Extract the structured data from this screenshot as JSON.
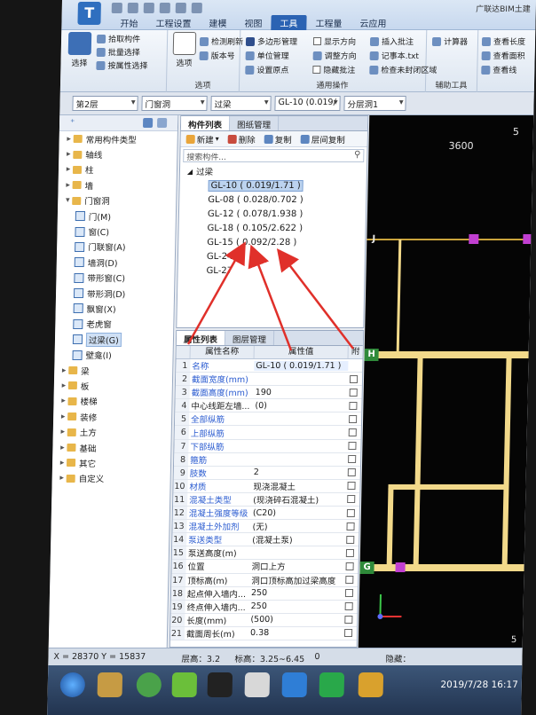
{
  "title_bar": {
    "logo_text": "T",
    "menu_tabs": [
      "开始",
      "工程设置",
      "建模",
      "视图",
      "工具",
      "工程量",
      "云应用"
    ],
    "active_tab": "工具",
    "brand_text": "广联达BIM土建"
  },
  "ribbon": {
    "select_group": {
      "select_button": "选择",
      "pick_component": "拾取构件",
      "batch_select": "批量选择",
      "select_by_attr": "按属性选择"
    },
    "options_group": {
      "options_button": "选项",
      "check_refresh": "检测刷新",
      "version": "版本号",
      "label": "选项"
    },
    "common_group": {
      "polygon_mgmt": "多边形管理",
      "show_direction": "显示方向",
      "insert_annotation": "插入批注",
      "unit_mgmt": "单位管理",
      "adjust_direction": "调整方向",
      "notepad": "记事本.txt",
      "set_origin": "设置原点",
      "hide_annotation": "隐藏批注",
      "check_unclosed": "检查未封闭区域",
      "label": "通用操作"
    },
    "aux_group": {
      "calculator": "计算器",
      "label": "辅助工具"
    },
    "view_group": {
      "view_length": "查看长度",
      "view_area": "查看面积",
      "view_line": "查看线"
    }
  },
  "selector_bar": {
    "floor": "第2层",
    "category": "门窗洞",
    "type": "过梁",
    "component": "GL-10 (0.019/",
    "layer": "分层洞1"
  },
  "tree": {
    "items": [
      {
        "label": "常用构件类型",
        "toggle": "▸",
        "kind": "folder"
      },
      {
        "label": "轴线",
        "toggle": "▸",
        "kind": "folder"
      },
      {
        "label": "柱",
        "toggle": "▸",
        "kind": "folder"
      },
      {
        "label": "墙",
        "toggle": "▸",
        "kind": "folder"
      },
      {
        "label": "门窗洞",
        "toggle": "▾",
        "kind": "folder"
      },
      {
        "label": "门(M)",
        "toggle": "",
        "kind": "child"
      },
      {
        "label": "窗(C)",
        "toggle": "",
        "kind": "child"
      },
      {
        "label": "门联窗(A)",
        "toggle": "",
        "kind": "child"
      },
      {
        "label": "墙洞(D)",
        "toggle": "",
        "kind": "child"
      },
      {
        "label": "带形窗(C)",
        "toggle": "",
        "kind": "child"
      },
      {
        "label": "带形洞(D)",
        "toggle": "",
        "kind": "child"
      },
      {
        "label": "飘窗(X)",
        "toggle": "",
        "kind": "child"
      },
      {
        "label": "老虎窗",
        "toggle": "",
        "kind": "child"
      },
      {
        "label": "过梁(G)",
        "toggle": "",
        "kind": "child",
        "selected": true
      },
      {
        "label": "壁龛(I)",
        "toggle": "",
        "kind": "child"
      },
      {
        "label": "梁",
        "toggle": "▸",
        "kind": "folder"
      },
      {
        "label": "板",
        "toggle": "▸",
        "kind": "folder"
      },
      {
        "label": "楼梯",
        "toggle": "▸",
        "kind": "folder"
      },
      {
        "label": "装修",
        "toggle": "▸",
        "kind": "folder"
      },
      {
        "label": "土方",
        "toggle": "▸",
        "kind": "folder"
      },
      {
        "label": "基础",
        "toggle": "▸",
        "kind": "folder"
      },
      {
        "label": "其它",
        "toggle": "▸",
        "kind": "folder"
      },
      {
        "label": "自定义",
        "toggle": "▸",
        "kind": "folder"
      }
    ]
  },
  "component_panel": {
    "tabs": [
      "构件列表",
      "图纸管理"
    ],
    "toolbar": {
      "new": "新建",
      "delete": "删除",
      "copy": "复制",
      "floor_copy": "层间复制"
    },
    "search_placeholder": "搜索构件...",
    "root": "过梁",
    "items": [
      {
        "label": "GL-10 ( 0.019/1.71 )",
        "selected": true
      },
      {
        "label": "GL-08 ( 0.028/0.702 )"
      },
      {
        "label": "GL-12 ( 0.078/1.938 )"
      },
      {
        "label": "GL-18 ( 0.105/2.622 )"
      },
      {
        "label": "GL-15 ( 0.092/2.28 )"
      },
      {
        "label": "GL-24"
      },
      {
        "label": "GL-27"
      }
    ]
  },
  "property_panel": {
    "tabs": [
      "属性列表",
      "图层管理"
    ],
    "headers": {
      "name": "属性名称",
      "value": "属性值",
      "attach": "附"
    },
    "rows": [
      {
        "n": "1",
        "k": "名称",
        "v": "GL-10 ( 0.019/1.71 )",
        "blue": true
      },
      {
        "n": "2",
        "k": "截面宽度(mm)",
        "v": "",
        "blue": true
      },
      {
        "n": "3",
        "k": "截面高度(mm)",
        "v": "190",
        "blue": true
      },
      {
        "n": "4",
        "k": "中心线距左墙...",
        "v": "(0)",
        "blue": false
      },
      {
        "n": "5",
        "k": "全部纵筋",
        "v": "",
        "blue": true
      },
      {
        "n": "6",
        "k": "上部纵筋",
        "v": "",
        "blue": true
      },
      {
        "n": "7",
        "k": "下部纵筋",
        "v": "",
        "blue": true
      },
      {
        "n": "8",
        "k": "箍筋",
        "v": "",
        "blue": true
      },
      {
        "n": "9",
        "k": "肢数",
        "v": "2",
        "blue": true
      },
      {
        "n": "10",
        "k": "材质",
        "v": "现浇混凝土",
        "blue": true
      },
      {
        "n": "11",
        "k": "混凝土类型",
        "v": "(现浇碎石混凝土)",
        "blue": true
      },
      {
        "n": "12",
        "k": "混凝土强度等级",
        "v": "(C20)",
        "blue": true
      },
      {
        "n": "13",
        "k": "混凝土外加剂",
        "v": "(无)",
        "blue": true
      },
      {
        "n": "14",
        "k": "泵送类型",
        "v": "(混凝土泵)",
        "blue": true
      },
      {
        "n": "15",
        "k": "泵送高度(m)",
        "v": "",
        "blue": false
      },
      {
        "n": "16",
        "k": "位置",
        "v": "洞口上方",
        "blue": false
      },
      {
        "n": "17",
        "k": "顶标高(m)",
        "v": "洞口顶标高加过梁高度",
        "blue": false
      },
      {
        "n": "18",
        "k": "起点伸入墙内...",
        "v": "250",
        "blue": false
      },
      {
        "n": "19",
        "k": "终点伸入墙内...",
        "v": "250",
        "blue": false
      },
      {
        "n": "20",
        "k": "长度(mm)",
        "v": "(500)",
        "blue": false
      },
      {
        "n": "21",
        "k": "截面周长(m)",
        "v": "0.38",
        "blue": false
      }
    ]
  },
  "canvas": {
    "dim_label": "3600",
    "axis_top": "5",
    "axis_bottom": "5",
    "axis_labels": [
      "J",
      "H",
      "G"
    ],
    "beam_color": "#f2d98a",
    "grid_color": "#e53a3a",
    "node_color": "#c13fd1"
  },
  "status_bar": {
    "coords": "X = 28370 Y = 15837",
    "floor_height": "层高：3.2",
    "elevation": "标高：3.25~6.45",
    "zero": "0",
    "hidden": "隐藏："
  },
  "taskbar": {
    "datetime": "2019/7/28 16:17"
  },
  "colors": {
    "annotation_arrow": "#e0302a",
    "ribbon_active": "#2b63b3"
  }
}
